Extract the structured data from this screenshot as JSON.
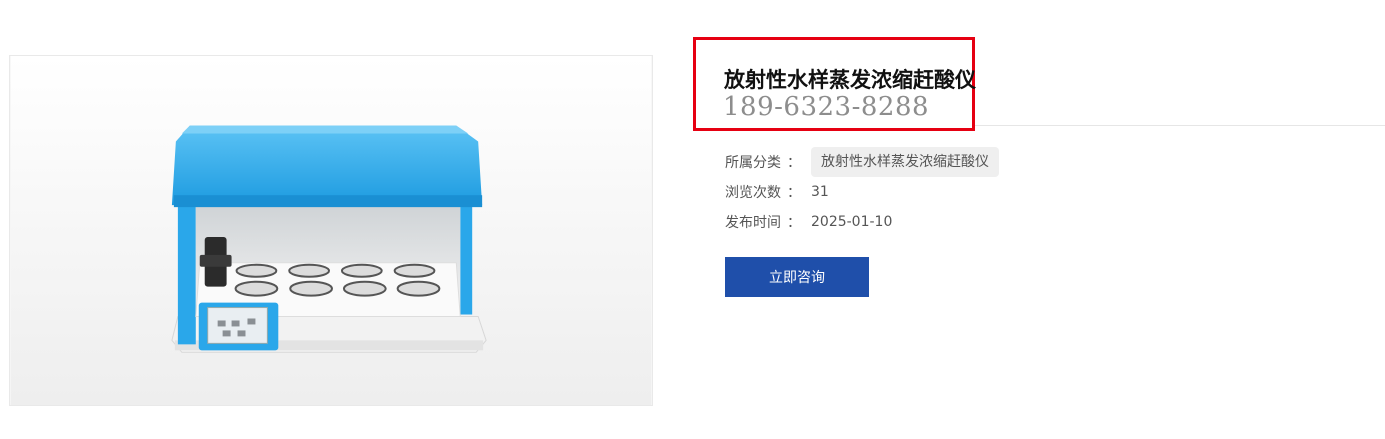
{
  "product": {
    "title": "放射性水样蒸发浓缩赶酸仪",
    "phone": "189-6323-8288",
    "image_alt": "放射性水样蒸发浓缩赶酸仪"
  },
  "meta": {
    "category_label": "所属分类",
    "category_value": "放射性水样蒸发浓缩赶酸仪",
    "views_label": "浏览次数",
    "views_value": "31",
    "date_label": "发布时间",
    "date_value": "2025-01-10",
    "separator": "："
  },
  "actions": {
    "consult_label": "立即咨询"
  },
  "colors": {
    "highlight_border": "#e60012",
    "button_bg": "#1f4faa",
    "device_blue": "#2aa7ea"
  }
}
